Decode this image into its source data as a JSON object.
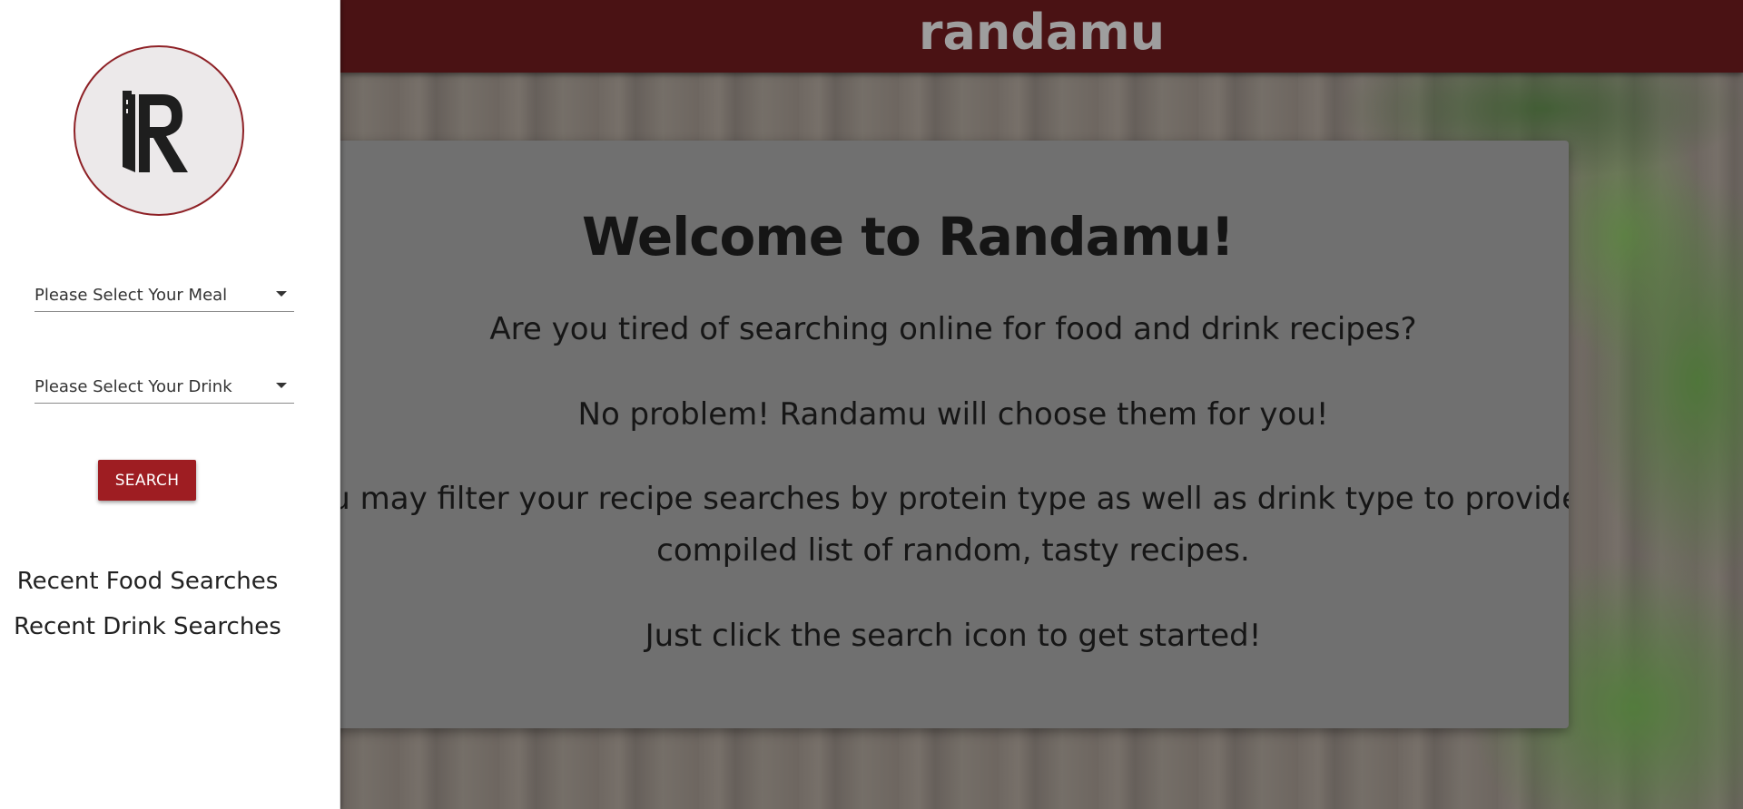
{
  "header": {
    "brand": "randamu"
  },
  "sidebar": {
    "logo_letter": "R",
    "meal_select": {
      "selected": "Please Select Your Meal"
    },
    "drink_select": {
      "selected": "Please Select Your Drink"
    },
    "search_label": "SEARCH",
    "recent_food": "Recent Food Searches",
    "recent_drink": "Recent Drink Searches"
  },
  "main": {
    "title": "Welcome to Randamu!",
    "paragraph_1": "Are you tired of searching online for food and drink recipes?",
    "paragraph_2": "No problem! Randamu will choose them for you!",
    "paragraph_3": "You may filter your recipe searches by protein type as well as drink type to provide a compiled list of random, tasty recipes.",
    "paragraph_4": "Just click the search icon to get started!"
  },
  "colors": {
    "topbar": "#4a1214",
    "accent": "#9e1d22",
    "card": "#707070"
  }
}
